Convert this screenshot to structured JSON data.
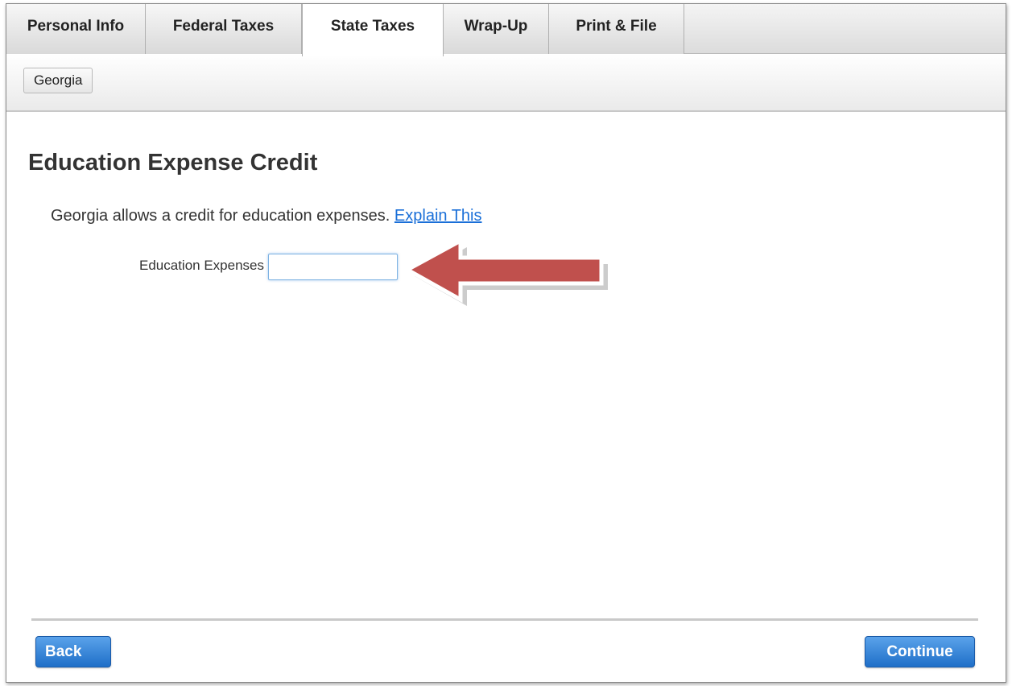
{
  "tabs": [
    {
      "label": "Personal Info",
      "active": false
    },
    {
      "label": "Federal Taxes",
      "active": false
    },
    {
      "label": "State Taxes",
      "active": true
    },
    {
      "label": "Wrap-Up",
      "active": false
    },
    {
      "label": "Print & File",
      "active": false
    }
  ],
  "subnav": {
    "state_label": "Georgia"
  },
  "page": {
    "title": "Education Expense Credit",
    "intro_text": "Georgia allows a credit for education expenses.",
    "explain_link": "Explain This"
  },
  "form": {
    "education_expenses_label": "Education Expenses",
    "education_expenses_value": ""
  },
  "annotation": {
    "arrow_color": "#c0504d",
    "icon": "left-arrow-icon"
  },
  "footer": {
    "back_label": "Back",
    "continue_label": "Continue"
  },
  "colors": {
    "button_blue": "#2a7bd3",
    "link_blue": "#1a6fd8"
  }
}
